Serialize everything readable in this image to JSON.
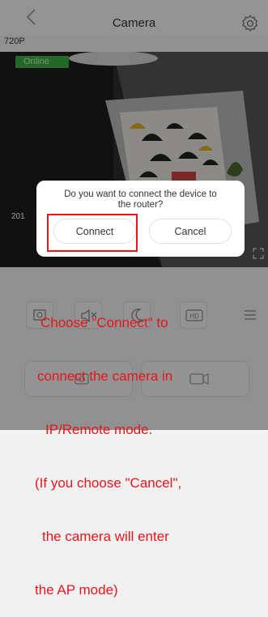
{
  "header": {
    "title": "Camera"
  },
  "resolution": "720P",
  "status": "Online",
  "video": {
    "timestamp": "201"
  },
  "dialog": {
    "message_line1": "Do you want to connect the device to",
    "message_line2": "the router?",
    "connect_label": "Connect",
    "cancel_label": "Cancel"
  },
  "controls": {
    "hd_label": "HD"
  },
  "annotation": {
    "line1": "Choose \"Connect\" to",
    "line2": "connect the camera in",
    "line3": "IP/Remote mode.",
    "line4": "(If you choose \"Cancel\",",
    "line5": "the camera will enter",
    "line6": "the AP mode)"
  },
  "colors": {
    "online_green": "#3cae42",
    "annotation_red": "#e8151b",
    "highlight_red": "#e21a1a"
  },
  "icons": [
    "back-icon",
    "gear-icon",
    "expand-icon",
    "screenshot-icon",
    "mute-icon",
    "night-icon",
    "hd-icon",
    "menu-icon",
    "camera-icon",
    "video-record-icon"
  ]
}
